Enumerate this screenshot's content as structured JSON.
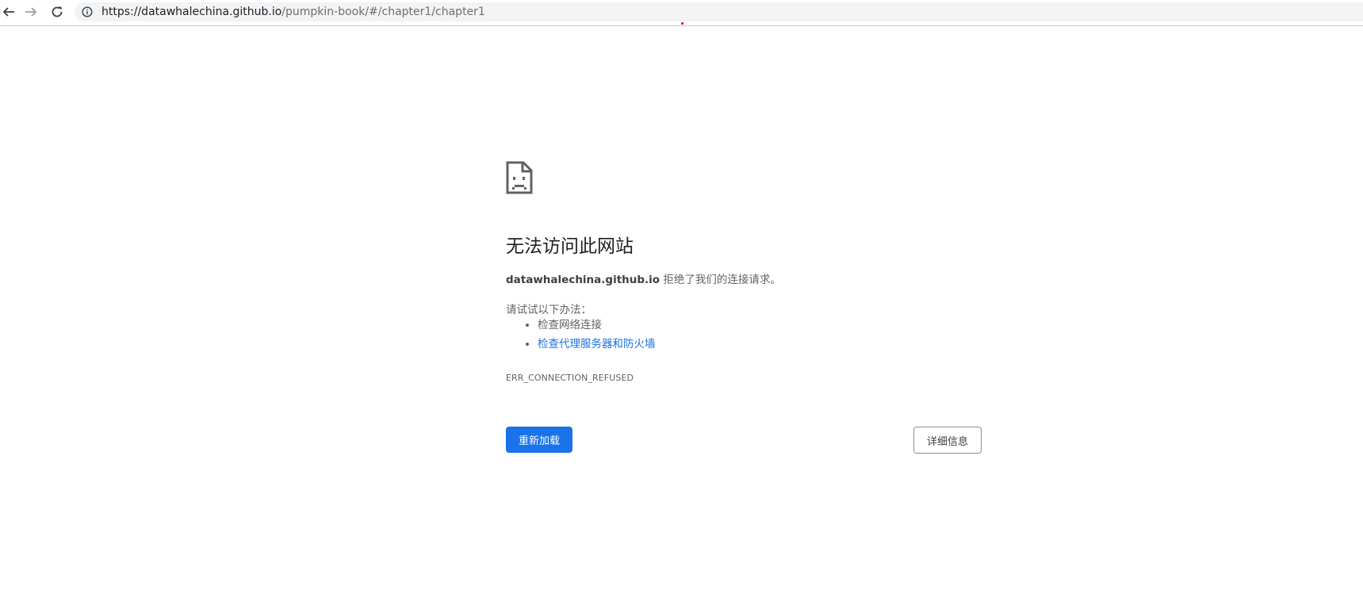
{
  "browser": {
    "url_host": "https://datawhalechina.github.io",
    "url_path": "/pumpkin-book/#/chapter1/chapter1"
  },
  "icons": {
    "back": "back-arrow-icon",
    "forward": "forward-arrow-icon",
    "reload": "reload-icon",
    "info": "info-icon",
    "error": "sad-page-icon"
  },
  "error_page": {
    "title": "无法访问此网站",
    "host": "datawhalechina.github.io",
    "host_suffix": " 拒绝了我们的连接请求。",
    "suggestions_heading": "请试试以下办法：",
    "suggestions": [
      "检查网络连接",
      "检查代理服务器和防火墙"
    ],
    "error_code": "ERR_CONNECTION_REFUSED",
    "reload_button": "重新加载",
    "details_button": "详细信息"
  },
  "colors": {
    "primary_blue": "#1a73e8",
    "omnibox_bg": "#f1f3f4",
    "progress_red": "#d93025"
  }
}
